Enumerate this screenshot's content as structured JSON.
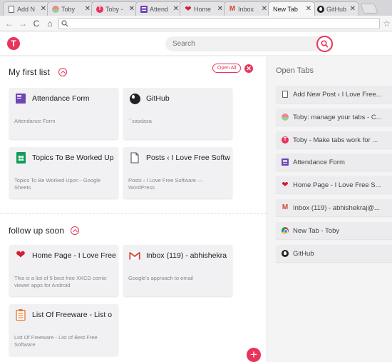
{
  "browser": {
    "tabs": [
      {
        "label": "Add N",
        "icon": "document-icon",
        "active": false
      },
      {
        "label": "Toby",
        "icon": "toby-favicon",
        "active": false
      },
      {
        "label": "Toby -",
        "icon": "toby-logo-icon",
        "active": false
      },
      {
        "label": "Attend",
        "icon": "forms-icon",
        "active": false
      },
      {
        "label": "Home",
        "icon": "heart-icon",
        "active": false
      },
      {
        "label": "Inbox",
        "icon": "gmail-icon",
        "active": false
      },
      {
        "label": "New Tab",
        "icon": "",
        "active": true
      },
      {
        "label": "GitHub",
        "icon": "github-icon",
        "active": false
      }
    ],
    "tab_close": "✕",
    "address_value": ""
  },
  "app": {
    "search_placeholder": "Search",
    "accent_color": "#e8345b"
  },
  "collections": [
    {
      "title": "My first list",
      "open_all_label": "Open All",
      "cards": [
        {
          "title": "Attendance Form",
          "desc": "Attendance Form",
          "icon": "forms-icon"
        },
        {
          "title": "GitHub",
          "desc": "``sasdasa",
          "icon": "github-icon"
        },
        {
          "title": "Topics To Be Worked Up",
          "desc": "Topics To Be Worked Upon - Google Sheets",
          "icon": "sheets-icon"
        },
        {
          "title": "Posts ‹ I Love Free Softw",
          "desc": "Posts ‹ I Love Free Software — WordPress",
          "icon": "document-icon"
        }
      ]
    },
    {
      "title": "follow up soon",
      "cards": [
        {
          "title": "Home Page - I Love Free",
          "desc": "This is a list of 5 best free XKCD comic viewer apps for Android",
          "icon": "heart-icon"
        },
        {
          "title": "Inbox (119) - abhishekra",
          "desc": "Google's approach to email",
          "icon": "gmail-icon"
        },
        {
          "title": "List Of Freeware - List o",
          "desc": "List Of Freeware - List of Best Free Software",
          "icon": "list-icon"
        }
      ]
    }
  ],
  "sidebar": {
    "title": "Open Tabs",
    "items": [
      {
        "label": "Add New Post ‹ I Love Free...",
        "icon": "document-icon"
      },
      {
        "label": "Toby: manage your tabs - C...",
        "icon": "toby-favicon"
      },
      {
        "label": "Toby - Make tabs work for ...",
        "icon": "toby-logo-icon"
      },
      {
        "label": "Attendance Form",
        "icon": "forms-icon"
      },
      {
        "label": "Home Page - I Love Free S...",
        "icon": "heart-icon"
      },
      {
        "label": "Inbox (119) - abhishekraj@...",
        "icon": "gmail-icon"
      },
      {
        "label": "New Tab - Toby",
        "icon": "chrome-icon"
      },
      {
        "label": "GitHub",
        "icon": "github-icon"
      }
    ]
  }
}
